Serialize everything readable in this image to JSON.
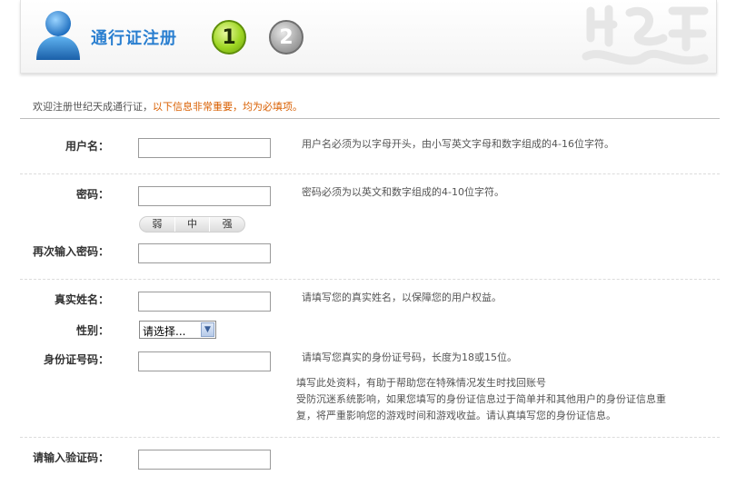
{
  "header": {
    "title": "通行证注册",
    "steps": [
      "1",
      "2"
    ]
  },
  "welcome": {
    "text": "欢迎注册世纪天成通行证，",
    "highlight": "以下信息非常重要，均为必填项。"
  },
  "form": {
    "username": {
      "label": "用户名：",
      "value": "",
      "hint": "用户名必须为以字母开头，由小写英文字母和数字组成的4-16位字符。"
    },
    "password": {
      "label": "密码：",
      "value": "",
      "hint": "密码必须为以英文和数字组成的4-10位字符。",
      "strength": [
        "弱",
        "中",
        "强"
      ]
    },
    "confirm_password": {
      "label": "再次输入密码：",
      "value": ""
    },
    "real_name": {
      "label": "真实姓名：",
      "value": "",
      "hint": "请填写您的真实姓名，以保障您的用户权益。"
    },
    "gender": {
      "label": "性别：",
      "selected": "请选择..."
    },
    "id_number": {
      "label": "身份证号码：",
      "value": "",
      "hint": "请填写您真实的身份证号码，长度为18或15位。",
      "note_lines": [
        "填写此处资料，有助于帮助您在特殊情况发生时找回账号",
        "受防沉迷系统影响，如果您填写的身份证信息过于简单并和其他用户的身份证信息重",
        "复，将严重影响您的游戏时间和游戏收益。请认真填写您的身份证信息。"
      ]
    },
    "captcha": {
      "label": "请输入验证码：",
      "value": ""
    }
  },
  "colors": {
    "title": "#2a7fd0",
    "highlight": "#d95f00",
    "step_active": "#9ed623",
    "step_inactive": "#a9a9a9"
  },
  "icons": {
    "avatar": "user-avatar-icon",
    "select_arrow": "chevron-down-icon"
  }
}
